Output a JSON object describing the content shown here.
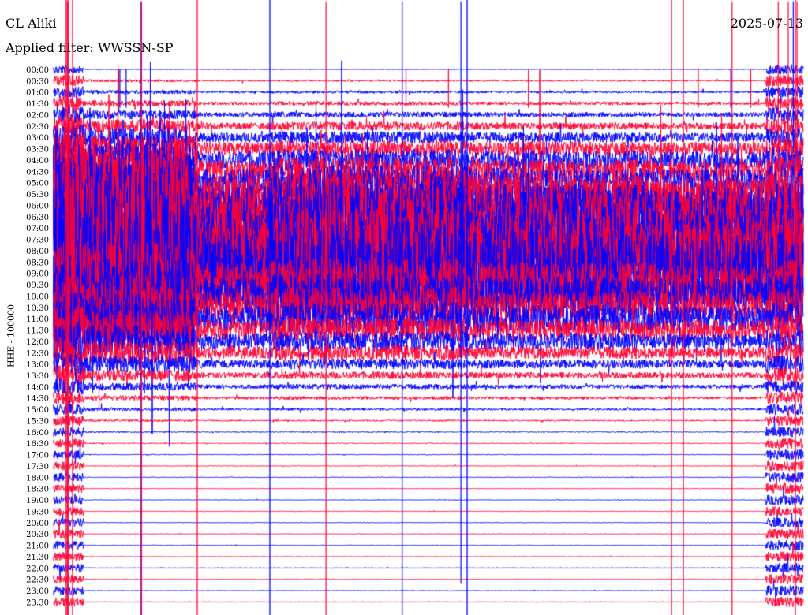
{
  "header": {
    "station": "CL Aliki",
    "filter": "Applied filter: WWSSN-SP",
    "date": "2025-07-13"
  },
  "chart_data": {
    "type": "line",
    "title": "CL Aliki",
    "subtitle": "Applied filter: WWSSN-SP",
    "ylabel": "HHE - 100000",
    "colors": {
      "blue": "#0000ff",
      "red": "#ff0033"
    },
    "rows": [
      "00:00",
      "00:30",
      "01:00",
      "01:30",
      "02:00",
      "02:30",
      "03:00",
      "03:30",
      "04:00",
      "04:30",
      "05:00",
      "05:30",
      "06:00",
      "06:30",
      "07:00",
      "07:30",
      "08:00",
      "08:30",
      "09:00",
      "09:30",
      "10:00",
      "10:30",
      "11:00",
      "11:30",
      "12:00",
      "12:30",
      "13:00",
      "13:30",
      "14:00",
      "14:30",
      "15:00",
      "15:30",
      "16:00",
      "16:30",
      "17:00",
      "17:30",
      "18:00",
      "18:30",
      "19:00",
      "19:30",
      "20:00",
      "20:30",
      "21:00",
      "21:30",
      "22:00",
      "22:30",
      "23:00",
      "23:30"
    ],
    "bursts": [
      {
        "t": 0.5,
        "color": "red",
        "rel": [
          -1.5,
          27
        ]
      },
      {
        "t": 0.54,
        "color": "red",
        "rel": [
          -1,
          27
        ]
      },
      {
        "t": 0.58,
        "color": "red",
        "rel": [
          -1,
          27
        ]
      },
      {
        "t": 2.6,
        "color": "red",
        "rel": [
          0,
          1
        ]
      },
      {
        "t": 2.65,
        "color": "blue",
        "rel": [
          0,
          1
        ]
      },
      {
        "t": 2.9,
        "color": "blue",
        "rel": [
          0,
          1
        ]
      },
      {
        "t": 3.5,
        "color": "blue",
        "rel": [
          -1,
          27
        ]
      },
      {
        "t": 3.52,
        "color": "red",
        "rel": [
          -1,
          27
        ]
      },
      {
        "t": 10.9,
        "color": "red",
        "rel": [
          -1,
          27
        ]
      },
      {
        "t": 13.95,
        "color": "blue",
        "rel": [
          -1,
          27
        ]
      },
      {
        "t": 14.1,
        "color": "red",
        "rel": [
          0,
          1
        ]
      },
      {
        "t": 15.8,
        "color": "red",
        "rel": [
          0,
          1
        ]
      },
      {
        "t": 16.3,
        "color": "blue",
        "rel": [
          -1,
          22
        ]
      },
      {
        "t": 19.0,
        "color": "red",
        "rel": [
          0,
          1
        ]
      },
      {
        "t": 25.8,
        "color": "red",
        "rel": [
          0,
          1
        ]
      },
      {
        "t": 27.1,
        "color": "blue",
        "rel": [
          0,
          1
        ]
      },
      {
        "t": 27.15,
        "color": "red",
        "rel": [
          -1,
          27
        ]
      },
      {
        "t": 27.9,
        "color": "red",
        "rel": [
          0,
          1
        ]
      },
      {
        "t": 29.0,
        "color": "red",
        "rel": [
          -1,
          4
        ]
      },
      {
        "t": 29.4,
        "color": "red",
        "rel": [
          -1,
          4
        ]
      },
      {
        "t": 29.6,
        "color": "blue",
        "rel": [
          -1,
          3
        ]
      },
      {
        "t": 29.75,
        "color": "red",
        "rel": [
          -1,
          8
        ]
      }
    ],
    "grid": false,
    "legend": "none"
  }
}
